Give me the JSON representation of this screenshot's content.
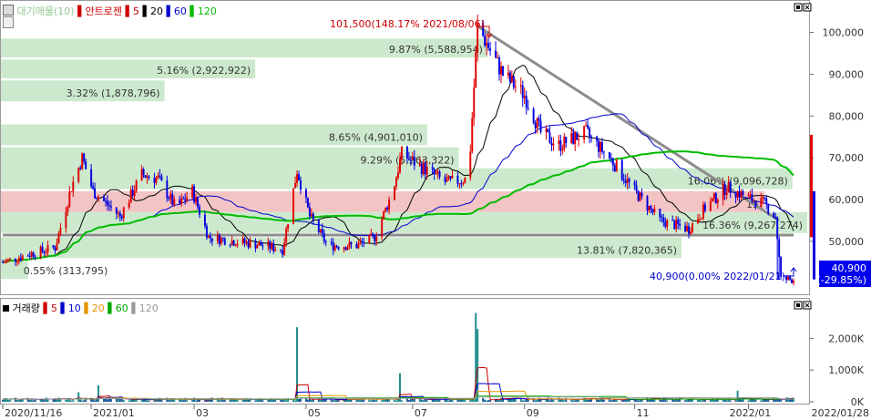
{
  "price_panel": {
    "legend": {
      "items": [
        {
          "label": "대기매물(10)",
          "color": "#9bd49b"
        },
        {
          "label": "안트로젠",
          "color": "#cc0000"
        },
        {
          "label": "5",
          "color": "#cc0000"
        },
        {
          "label": "20",
          "color": "#000000"
        },
        {
          "label": "60",
          "color": "#0000cc"
        },
        {
          "label": "120",
          "color": "#00bb00"
        }
      ]
    },
    "high_annotation": "101,500(148.17% 2021/08/06)",
    "low_annotation": "40,900(0.00% 2022/01/21)",
    "current_price": "40,900",
    "current_change": "(-29.85%)",
    "y_ticks": [
      "100,000",
      "90,000",
      "80,000",
      "70,000",
      "60,000",
      "50,000"
    ],
    "volume_profile": [
      {
        "label": "9.87% (5,588,954)",
        "pct": 9.87,
        "low": 94000,
        "high": 98500
      },
      {
        "label": "5.16% (2,922,922)",
        "pct": 5.16,
        "low": 89000,
        "high": 93500
      },
      {
        "label": "3.32% (1,878,796)",
        "pct": 3.32,
        "low": 83500,
        "high": 88500
      },
      {
        "label": "8.65% (4,901,010)",
        "pct": 8.65,
        "low": 73000,
        "high": 78000
      },
      {
        "label": "9.29% (5,263,322)",
        "pct": 9.29,
        "low": 67500,
        "high": 72500
      },
      {
        "label": "16.06% (9,096,728)",
        "pct": 16.06,
        "low": 62500,
        "high": 67500
      },
      {
        "label": "15.",
        "pct": 15.5,
        "low": 57000,
        "high": 62000,
        "highlight": true
      },
      {
        "label": "16.36% (9,267,274)",
        "pct": 16.36,
        "low": 52000,
        "high": 57000
      },
      {
        "label": "13.81% (7,820,365)",
        "pct": 13.81,
        "low": 46000,
        "high": 51000
      },
      {
        "label": "0.55% (313,795)",
        "pct": 0.55,
        "low": 41000,
        "high": 46000
      }
    ]
  },
  "volume_panel": {
    "legend": {
      "items": [
        {
          "label": "거래량",
          "color": "#000000"
        },
        {
          "label": "5",
          "color": "#cc0000"
        },
        {
          "label": "10",
          "color": "#0000cc"
        },
        {
          "label": "20",
          "color": "#e69500"
        },
        {
          "label": "60",
          "color": "#00aa00"
        },
        {
          "label": "120",
          "color": "#999999"
        }
      ]
    },
    "y_ticks": [
      "2,000K",
      "1,000K",
      "0K"
    ]
  },
  "x_ticks": [
    "2020/11/16",
    "2021/01",
    "03",
    "05",
    "07",
    "09",
    "11",
    "2022/01",
    "2022/01/28"
  ],
  "colors": {
    "up": "#e00000",
    "down": "#0000e0",
    "profile": "#cde9cd",
    "profile_highlight": "#f2c4c4",
    "trendline": "#8c8c8c"
  },
  "chart_data": {
    "type": "candlestick",
    "x_range": [
      "2020/11/16",
      "2022/01/28"
    ],
    "ylim": [
      38000,
      106000
    ],
    "volume_ylim_k": [
      0,
      2900
    ],
    "price_path": [
      [
        "2020/11/16",
        45000
      ],
      [
        "2020/12/01",
        47000
      ],
      [
        "2020/12/15",
        48500
      ],
      [
        "2020/12/24",
        63000
      ],
      [
        "2020/12/30",
        70000
      ],
      [
        "2021/01/05",
        62000
      ],
      [
        "2021/01/20",
        56000
      ],
      [
        "2021/02/01",
        66000
      ],
      [
        "2021/02/10",
        65000
      ],
      [
        "2021/02/20",
        58000
      ],
      [
        "2021/03/01",
        62000
      ],
      [
        "2021/03/10",
        51000
      ],
      [
        "2021/03/25",
        50000
      ],
      [
        "2021/04/10",
        49000
      ],
      [
        "2021/04/20",
        48000
      ],
      [
        "2021/04/28",
        67000
      ],
      [
        "2021/05/05",
        56000
      ],
      [
        "2021/05/15",
        49000
      ],
      [
        "2021/05/31",
        49000
      ],
      [
        "2021/06/10",
        51000
      ],
      [
        "2021/06/20",
        62000
      ],
      [
        "2021/06/25",
        71000
      ],
      [
        "2021/07/05",
        68000
      ],
      [
        "2021/07/20",
        64000
      ],
      [
        "2021/08/01",
        65000
      ],
      [
        "2021/08/06",
        101500
      ],
      [
        "2021/08/20",
        90000
      ],
      [
        "2021/09/01",
        85000
      ],
      [
        "2021/09/10",
        76000
      ],
      [
        "2021/09/20",
        73000
      ],
      [
        "2021/10/05",
        76000
      ],
      [
        "2021/10/20",
        69000
      ],
      [
        "2021/11/01",
        62000
      ],
      [
        "2021/11/15",
        55000
      ],
      [
        "2021/12/01",
        53000
      ],
      [
        "2021/12/10",
        58000
      ],
      [
        "2021/12/22",
        63000
      ],
      [
        "2022/01/05",
        60000
      ],
      [
        "2022/01/12",
        59000
      ],
      [
        "2022/01/18",
        56000
      ],
      [
        "2022/01/21",
        40900
      ],
      [
        "2022/01/28",
        40900
      ]
    ],
    "trendlines": [
      {
        "from": [
          "2021/08/06",
          101500
        ],
        "to": [
          "2022/01/20",
          55000
        ]
      },
      {
        "from": [
          "2020/11/16",
          51500
        ],
        "to": [
          "2022/01/28",
          51500
        ]
      }
    ],
    "volume_spikes_k": [
      [
        "2020/12/28",
        300
      ],
      [
        "2021/01/08",
        520
      ],
      [
        "2021/04/28",
        2350
      ],
      [
        "2021/06/24",
        900
      ],
      [
        "2021/08/05",
        2800
      ],
      [
        "2021/08/06",
        2300
      ],
      [
        "2021/12/28",
        350
      ]
    ]
  }
}
